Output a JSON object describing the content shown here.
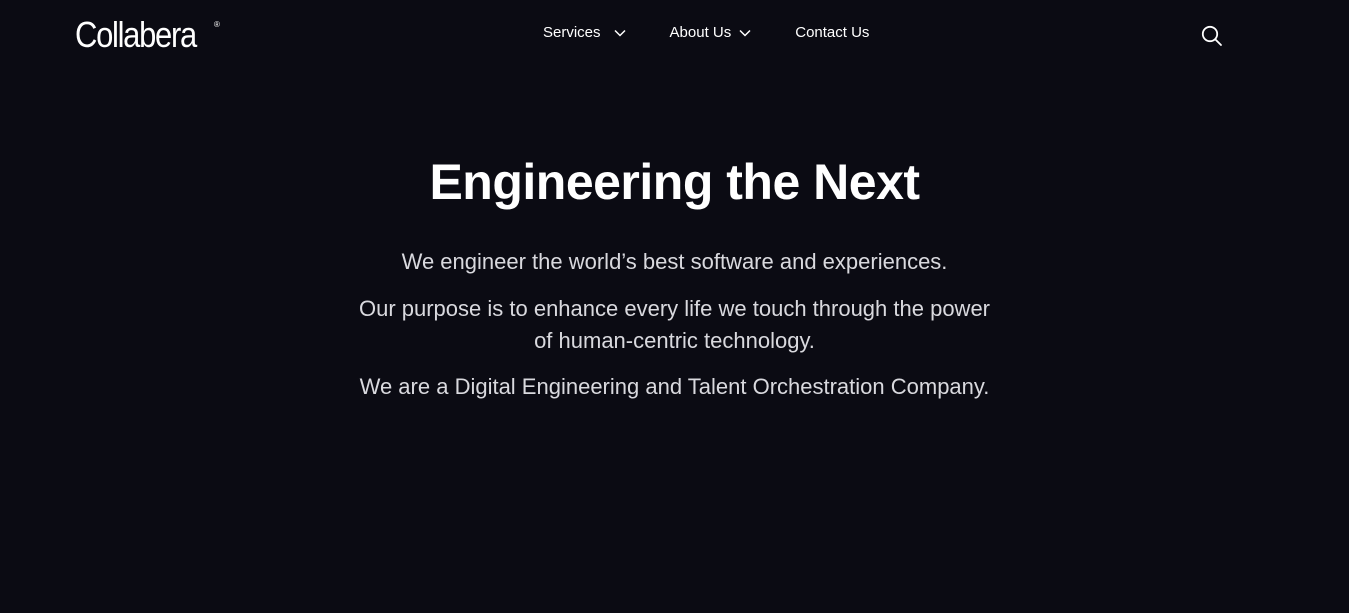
{
  "header": {
    "logo": {
      "text": "Collabera",
      "trademark": "®"
    },
    "nav": {
      "services": "Services",
      "about": "About Us",
      "contact": "Contact Us"
    },
    "search_icon": "search-icon"
  },
  "hero": {
    "title": "Engineering the Next",
    "line1": "We engineer the world’s best software and experiences.",
    "line2": "Our purpose is to enhance every life we touch through the power of human-centric technology.",
    "line3": "We are a Digital Engineering and Talent Orchestration Company."
  },
  "colors": {
    "background": "#0b0b13",
    "text": "#ffffff",
    "body_text": "#d9d9de"
  }
}
